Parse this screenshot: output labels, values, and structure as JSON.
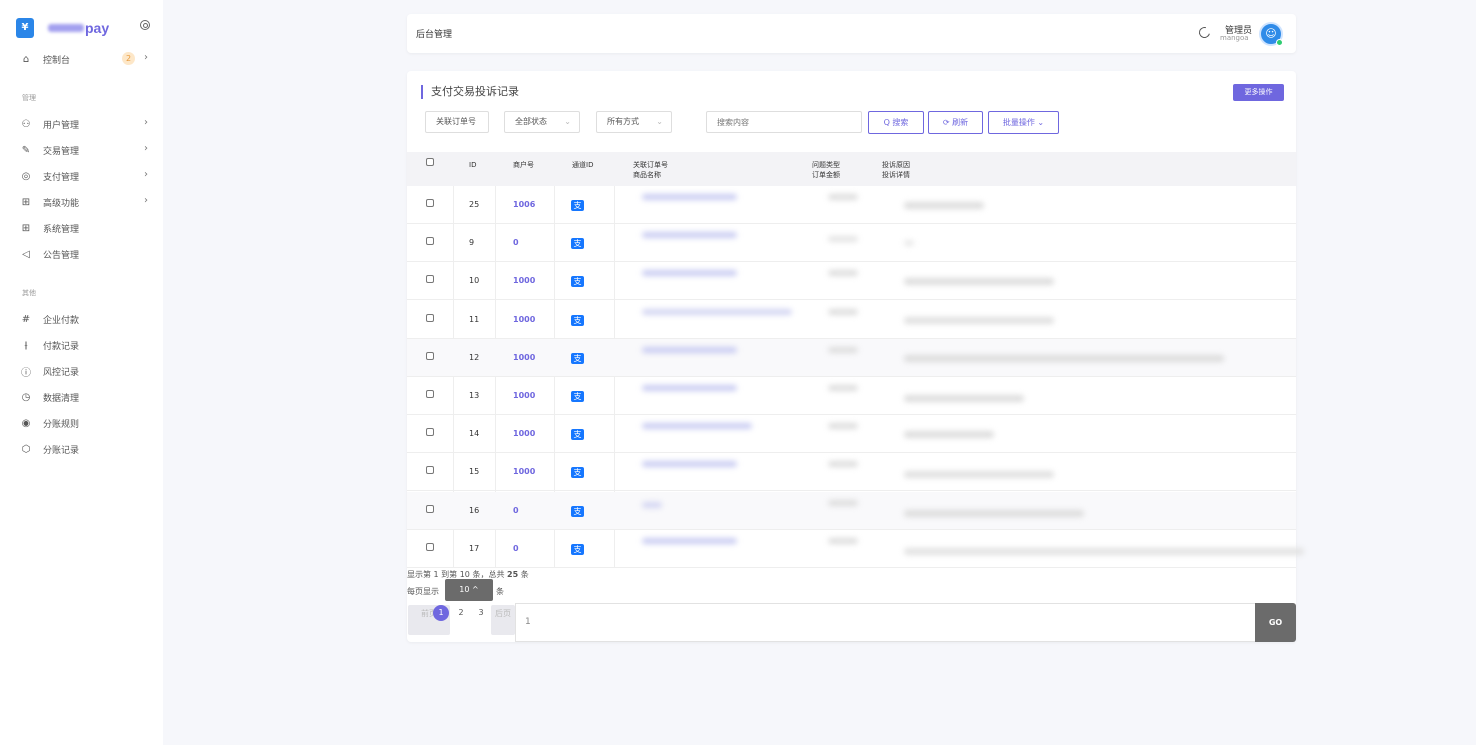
{
  "brand": {
    "name": "pay",
    "logo_glyph": "¥"
  },
  "sidebar": {
    "items_top": [
      {
        "label": "控制台",
        "badge": "2",
        "icon": "home-icon"
      }
    ],
    "group1_label": "管理",
    "group1": [
      {
        "label": "用户管理",
        "icon": "users-icon"
      },
      {
        "label": "交易管理",
        "icon": "edit-icon"
      },
      {
        "label": "支付管理",
        "icon": "check-circle-icon"
      },
      {
        "label": "高级功能",
        "icon": "grid-icon"
      },
      {
        "label": "系统管理",
        "icon": "grid-icon"
      },
      {
        "label": "公告管理",
        "icon": "speaker-icon"
      }
    ],
    "group2_label": "其他",
    "group2": [
      {
        "label": "企业付款",
        "icon": "slack-icon"
      },
      {
        "label": "付款记录",
        "icon": "sliders-icon"
      },
      {
        "label": "风控记录",
        "icon": "alert-circle-icon"
      },
      {
        "label": "数据清理",
        "icon": "clock-icon"
      },
      {
        "label": "分账规则",
        "icon": "chrome-icon"
      },
      {
        "label": "分账记录",
        "icon": "codesandbox-icon"
      }
    ]
  },
  "header": {
    "title": "后台管理",
    "user_name": "管理员",
    "user_sub": "mangoa"
  },
  "card": {
    "title": "支付交易投诉记录",
    "more_label": "更多操作",
    "filters": {
      "order": "关联订单号",
      "status": "全部状态",
      "method": "所有方式",
      "search_placeholder": "搜索内容"
    },
    "buttons": {
      "search": "Q 搜索",
      "refresh": "⟳ 刷新",
      "batch": "批量操作 ⌄"
    }
  },
  "table": {
    "headers": {
      "id": "ID",
      "merchant": "商户号",
      "channel": "通道ID",
      "order_line1": "关联订单号",
      "order_line2": "商品名称",
      "type_line1": "问题类型",
      "type_line2": "订单金额",
      "reason_line1": "投诉原因",
      "reason_line2": "投诉详情"
    },
    "rows": [
      {
        "id": "25",
        "merchant": "1006",
        "channel": "支"
      },
      {
        "id": "9",
        "merchant": "0",
        "channel": "支"
      },
      {
        "id": "10",
        "merchant": "1000",
        "channel": "支"
      },
      {
        "id": "11",
        "merchant": "1000",
        "channel": "支"
      },
      {
        "id": "12",
        "merchant": "1000",
        "channel": "支"
      },
      {
        "id": "13",
        "merchant": "1000",
        "channel": "支"
      },
      {
        "id": "14",
        "merchant": "1000",
        "channel": "支"
      },
      {
        "id": "15",
        "merchant": "1000",
        "channel": "支"
      },
      {
        "id": "16",
        "merchant": "0",
        "channel": "支"
      },
      {
        "id": "17",
        "merchant": "0",
        "channel": "支"
      }
    ]
  },
  "footer": {
    "summary_prefix": "显示第 1 到第 10 条，总共",
    "summary_total": "25",
    "summary_suffix": "条",
    "per_page_label": "每页显示",
    "per_page_value": "10 ^",
    "per_page_suffix": "条",
    "prev": "前页",
    "next": "后页",
    "pages": [
      "1",
      "2",
      "3"
    ],
    "jump_value": "1",
    "go": "GO"
  }
}
